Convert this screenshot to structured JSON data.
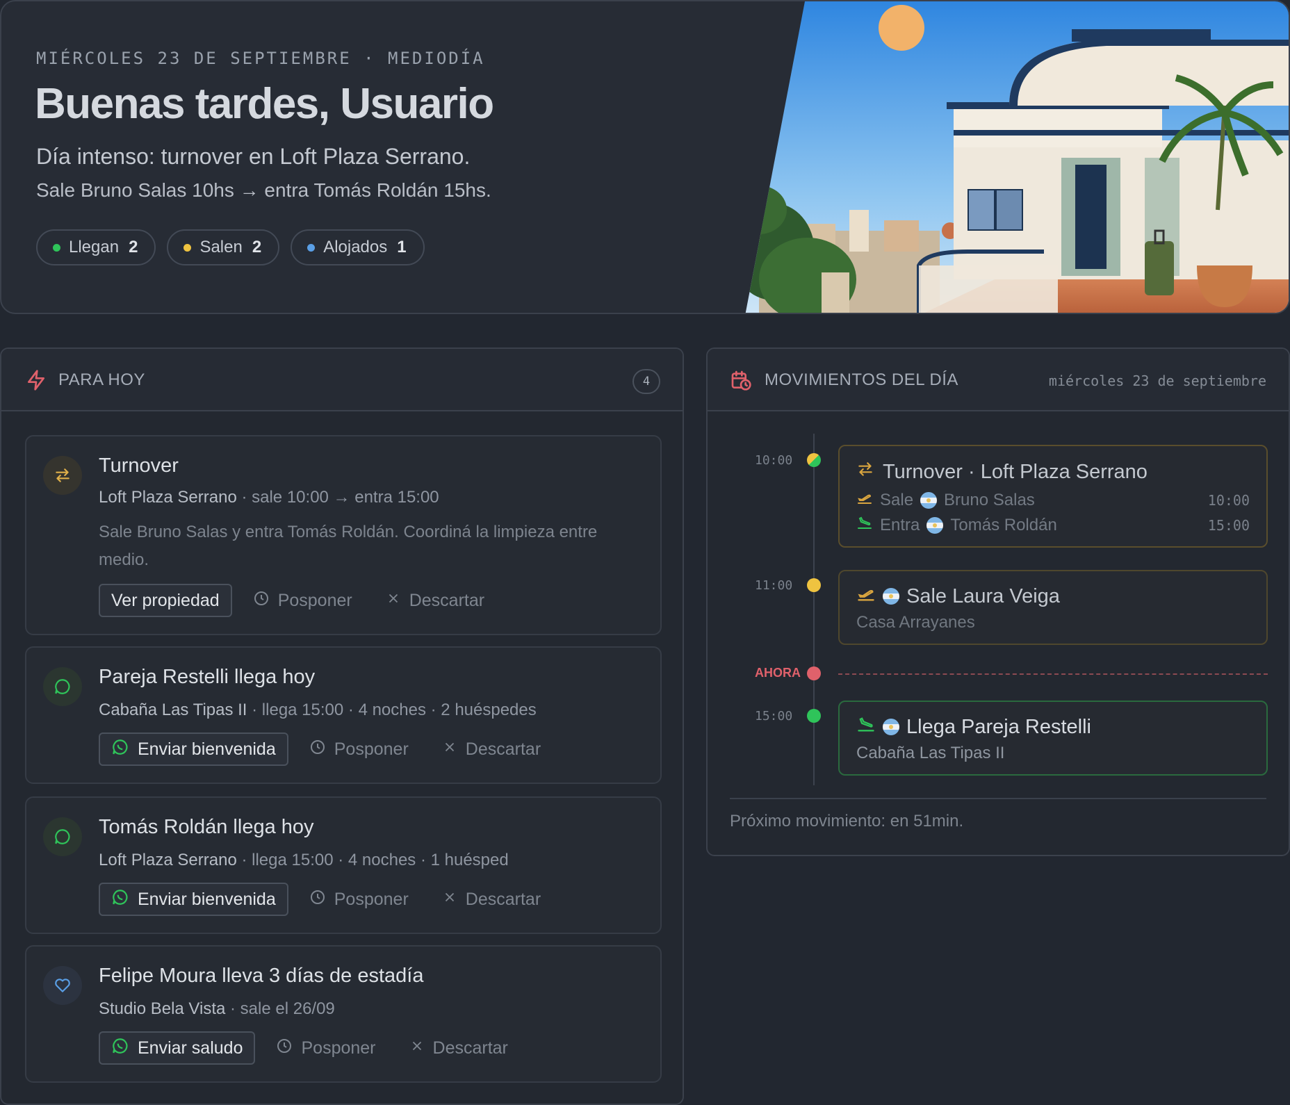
{
  "hero": {
    "date_line": "MIÉRCOLES 23 DE SEPTIEMBRE · MEDIODÍA",
    "greeting": "Buenas tardes, Usuario",
    "summary_line1": "Día intenso: turnover en Loft Plaza Serrano.",
    "summary_line2": "Sale Bruno Salas 10hs → entra Tomás Roldán 15hs.",
    "chips": [
      {
        "label": "Llegan",
        "count": "2",
        "color": "#2fc45a"
      },
      {
        "label": "Salen",
        "count": "2",
        "color": "#efc340"
      },
      {
        "label": "Alojados",
        "count": "1",
        "color": "#5a9fe6"
      }
    ]
  },
  "today": {
    "title": "PARA HOY",
    "count": "4",
    "cards": [
      {
        "title": "Turnover",
        "property": "Loft Plaza Serrano",
        "meta": "· sale 10:00 → entra 15:00",
        "description": "Sale Bruno Salas y entra Tomás Roldán. Coordiná la limpieza entre medio.",
        "primary": "Ver propiedad",
        "postpone": "Posponer",
        "dismiss": "Descartar"
      },
      {
        "title": "Pareja Restelli llega hoy",
        "property": "Cabaña Las Tipas II",
        "meta": "· llega 15:00 · 4 noches · 2 huéspedes",
        "primary": "Enviar bienvenida",
        "postpone": "Posponer",
        "dismiss": "Descartar"
      },
      {
        "title": "Tomás Roldán llega hoy",
        "property": "Loft Plaza Serrano",
        "meta": "· llega 15:00 · 4 noches · 1 huésped",
        "primary": "Enviar bienvenida",
        "postpone": "Posponer",
        "dismiss": "Descartar"
      },
      {
        "title": "Felipe Moura lleva 3 días de estadía",
        "property": "Studio Bela Vista",
        "meta": "· sale el 26/09",
        "primary": "Enviar saludo",
        "postpone": "Posponer",
        "dismiss": "Descartar"
      }
    ]
  },
  "movements": {
    "title": "MOVIMIENTOS DEL DÍA",
    "date": "miércoles 23 de septiembre",
    "now_label": "AHORA",
    "events": [
      {
        "time": "10:00",
        "title": "Turnover · Loft Plaza Serrano",
        "rows": [
          {
            "verb": "Sale",
            "guest": "Bruno Salas",
            "time": "10:00"
          },
          {
            "verb": "Entra",
            "guest": "Tomás Roldán",
            "time": "15:00"
          }
        ]
      },
      {
        "time": "11:00",
        "title": "Sale Laura Veiga",
        "subtitle": "Casa Arrayanes"
      },
      {
        "time": "15:00",
        "title": "Llega Pareja Restelli",
        "subtitle": "Cabaña Las Tipas II"
      }
    ],
    "footer": "Próximo movimiento: en 51min."
  },
  "colors": {
    "green": "#2fc45a",
    "yellow": "#efc340",
    "blue": "#5a9fe6",
    "red": "#e0616b",
    "turnover": "#d9a53f"
  }
}
